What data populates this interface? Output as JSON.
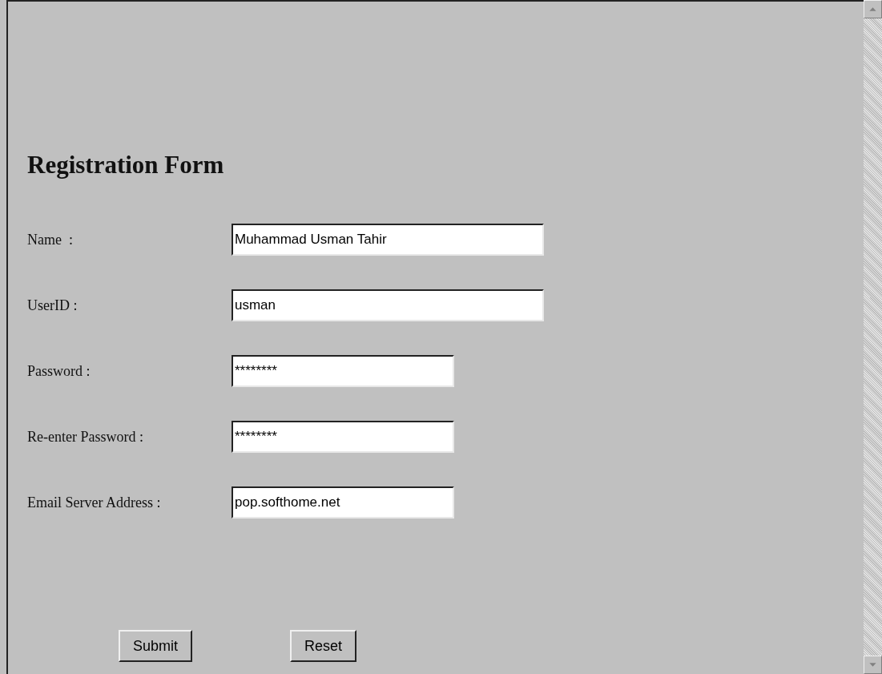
{
  "heading": "Registration Form",
  "fields": [
    {
      "label": "Name  :",
      "value": "Muhammad Usman Tahir"
    },
    {
      "label": "UserID :",
      "value": "usman"
    },
    {
      "label": "Password :",
      "value": "********"
    },
    {
      "label": "Re-enter Password :",
      "value": "********"
    },
    {
      "label": "Email Server Address :",
      "value": "pop.softhome.net"
    }
  ],
  "buttons": [
    "Submit",
    "Reset"
  ]
}
